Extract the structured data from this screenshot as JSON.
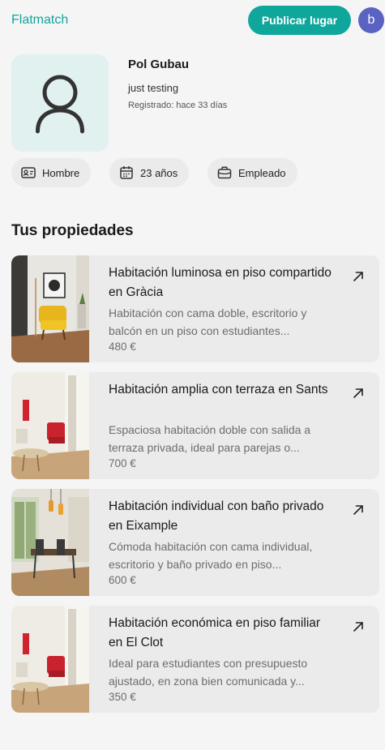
{
  "header": {
    "brand": "Flatmatch",
    "publish_label": "Publicar lugar",
    "avatar_letter": "b"
  },
  "profile": {
    "name": "Pol Gubau",
    "bio": "just testing",
    "registered": "Registrado: hace 33 días",
    "chips": [
      {
        "icon": "id-card-icon",
        "label": "Hombre"
      },
      {
        "icon": "calendar-icon",
        "label": "23 años"
      },
      {
        "icon": "briefcase-icon",
        "label": "Empleado"
      }
    ]
  },
  "properties": {
    "title": "Tus propiedades",
    "items": [
      {
        "title": "Habitación luminosa en piso compartido en Gràcia",
        "description": "Habitación con cama doble, escritorio y balcón en un piso con estudiantes...",
        "price": "480 €"
      },
      {
        "title": "Habitación amplia con terraza en Sants",
        "description": "Espaciosa habitación doble con salida a terraza privada, ideal para parejas o...",
        "price": "700 €"
      },
      {
        "title": "Habitación individual con baño privado en Eixample",
        "description": "Cómoda habitación con cama individual, escritorio y baño privado en piso...",
        "price": "600 €"
      },
      {
        "title": "Habitación económica en piso familiar en El Clot",
        "description": "Ideal para estudiantes con presupuesto ajustado, en zona bien comunicada y...",
        "price": "350 €"
      }
    ]
  },
  "colors": {
    "accent": "#0fa69c",
    "avatar": "#5b63c2",
    "photo_bg": "#e1f1ef"
  }
}
